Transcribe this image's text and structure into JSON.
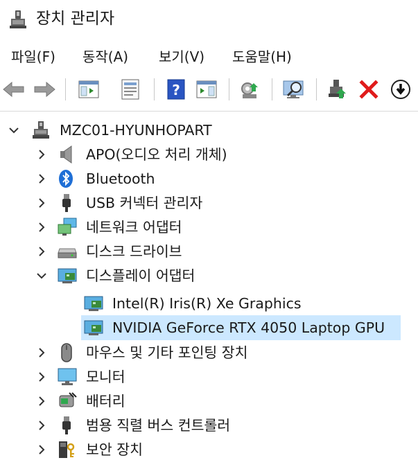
{
  "window": {
    "title": "장치 관리자"
  },
  "menu": [
    "파일(F)",
    "동작(A)",
    "보기(V)",
    "도움말(H)"
  ],
  "toolbar": {
    "buttons": [
      "back-icon",
      "forward-icon",
      "show-hide-tree-icon",
      "properties-icon",
      "help-icon",
      "action-pane-icon",
      "update-driver-icon",
      "scan-hardware-icon",
      "add-device-icon",
      "uninstall-icon",
      "disable-device-icon"
    ]
  },
  "tree": {
    "root": "MZC01-HYUNHOPART",
    "items": [
      {
        "label": "APO(오디오 처리 개체)",
        "icon": "speaker-icon"
      },
      {
        "label": "Bluetooth",
        "icon": "bluetooth-icon"
      },
      {
        "label": "USB 커넥터 관리자",
        "icon": "usb-icon"
      },
      {
        "label": "네트워크 어댑터",
        "icon": "network-icon"
      },
      {
        "label": "디스크 드라이브",
        "icon": "disk-icon"
      },
      {
        "label": "디스플레이 어댑터",
        "icon": "display-adapter-icon",
        "expanded": true,
        "children": [
          {
            "label": "Intel(R) Iris(R) Xe Graphics",
            "icon": "display-adapter-icon"
          },
          {
            "label": "NVIDIA GeForce RTX 4050 Laptop GPU",
            "icon": "display-adapter-icon",
            "selected": true
          }
        ]
      },
      {
        "label": "마우스 및 기타 포인팅 장치",
        "icon": "mouse-icon"
      },
      {
        "label": "모니터",
        "icon": "monitor-icon"
      },
      {
        "label": "배터리",
        "icon": "battery-icon"
      },
      {
        "label": "범용 직렬 버스 컨트롤러",
        "icon": "usb-controller-icon"
      },
      {
        "label": "보안 장치",
        "icon": "security-device-icon"
      }
    ]
  },
  "colors": {
    "selection": "#cce8ff",
    "accent": "#0078d4"
  }
}
